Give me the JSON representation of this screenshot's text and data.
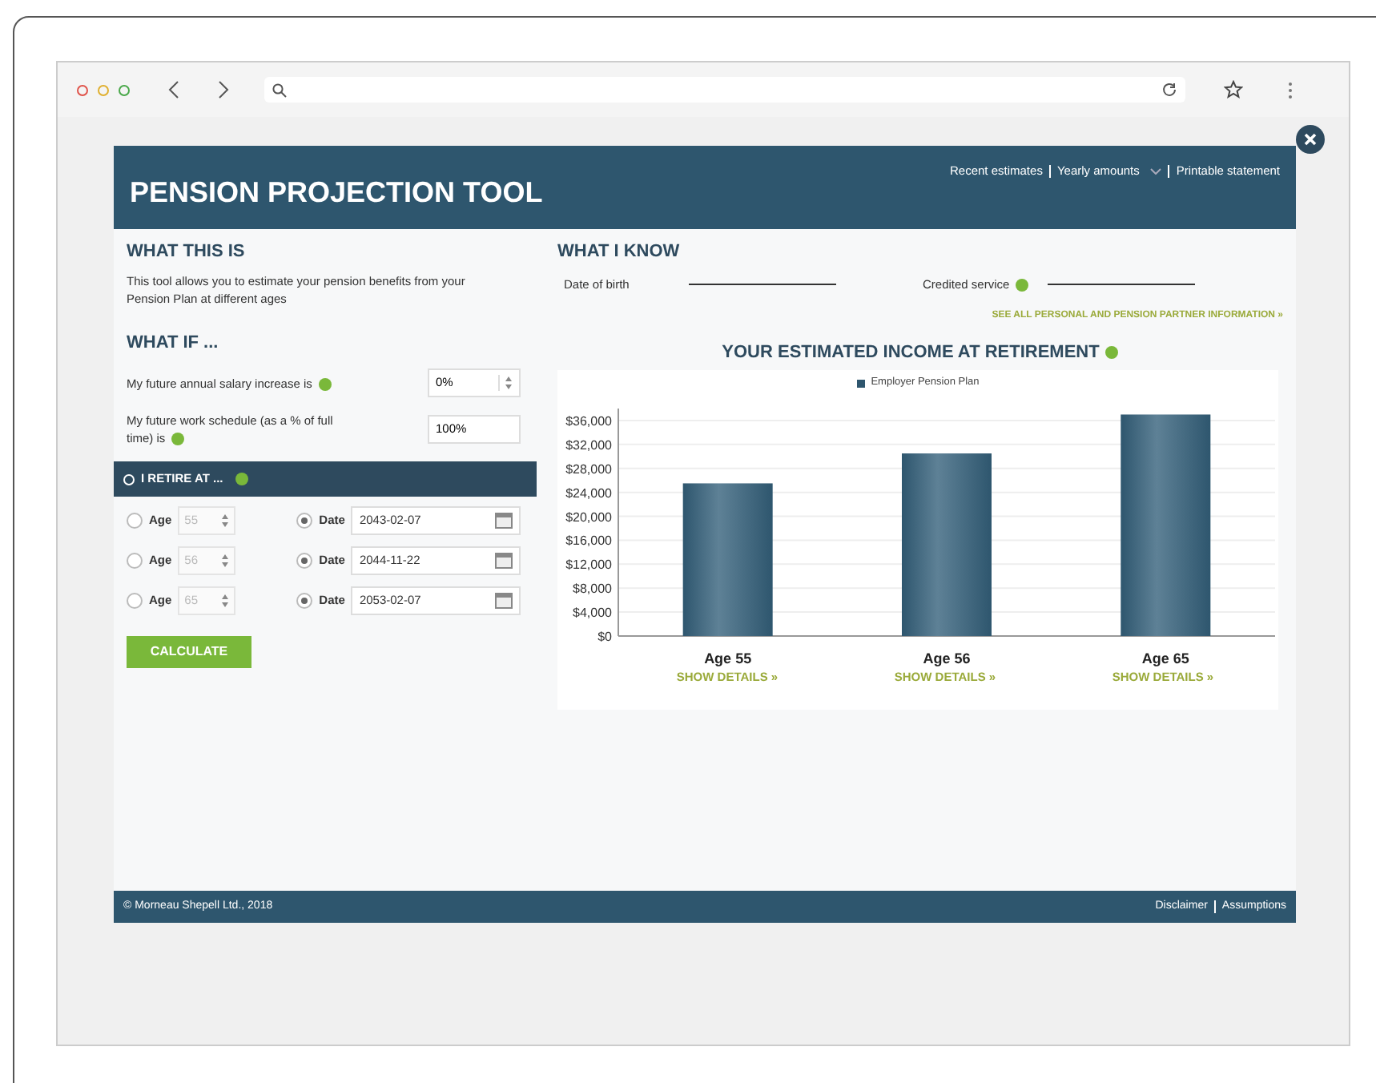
{
  "header": {
    "title": "PENSION PROJECTION TOOL",
    "links": [
      {
        "label": "Recent estimates",
        "kind": "link"
      },
      {
        "label": "Yearly amounts",
        "kind": "dropdown"
      },
      {
        "label": "Printable statement",
        "kind": "link"
      }
    ]
  },
  "what_this_is": {
    "heading": "WHAT THIS IS",
    "text": "This tool allows you to estimate your pension benefits from your Pension Plan at different ages"
  },
  "what_if": {
    "heading": "WHAT IF ...",
    "fields": [
      {
        "label": "My future annual salary increase is",
        "value": "0%",
        "kind": "spinner"
      },
      {
        "label": "My future work schedule (as a % of full time) is",
        "value": "100%",
        "kind": "text"
      }
    ]
  },
  "retire": {
    "heading": "I RETIRE AT ...",
    "options": [
      {
        "age_label": "Age",
        "age": "55",
        "age_selected": false,
        "date_label": "Date",
        "date": "2043-02-07",
        "date_selected": true
      },
      {
        "age_label": "Age",
        "age": "56",
        "age_selected": false,
        "date_label": "Date",
        "date": "2044-11-22",
        "date_selected": true
      },
      {
        "age_label": "Age",
        "age": "65",
        "age_selected": false,
        "date_label": "Date",
        "date": "2053-02-07",
        "date_selected": true
      }
    ],
    "button": "CALCULATE"
  },
  "what_i_know": {
    "heading": "WHAT I KNOW",
    "fields": [
      {
        "label": "Date of birth",
        "info": false
      },
      {
        "label": "Credited service",
        "info": true
      }
    ],
    "link": "SEE ALL PERSONAL AND PENSION PARTNER INFORMATION »"
  },
  "income": {
    "title": "YOUR ESTIMATED INCOME AT RETIREMENT",
    "details_links": [
      "SHOW DETAILS »",
      "SHOW DETAILS »",
      "SHOW DETAILS »"
    ],
    "chart_data": {
      "type": "bar",
      "categories": [
        "Age 55",
        "Age 56",
        "Age 65"
      ],
      "series": [
        {
          "name": "Employer Pension Plan",
          "color": "#2e566e",
          "values": [
            25500,
            30500,
            37000
          ]
        }
      ],
      "ylim": [
        0,
        38000
      ],
      "grid": true,
      "yticks": [
        {
          "value": 0,
          "label": "$0"
        },
        {
          "value": 4000,
          "label": "$4,000"
        },
        {
          "value": 8000,
          "label": "$8,000"
        },
        {
          "value": 12000,
          "label": "$12,000"
        },
        {
          "value": 16000,
          "label": "$16,000"
        },
        {
          "value": 20000,
          "label": "$20,000"
        },
        {
          "value": 24000,
          "label": "$24,000"
        },
        {
          "value": 28000,
          "label": "$28,000"
        },
        {
          "value": 32000,
          "label": "$32,000"
        },
        {
          "value": 36000,
          "label": "$36,000"
        }
      ]
    }
  },
  "footer": {
    "copyright": "© Morneau Shepell Ltd., 2018",
    "links": [
      "Disclaimer",
      "Assumptions"
    ]
  }
}
